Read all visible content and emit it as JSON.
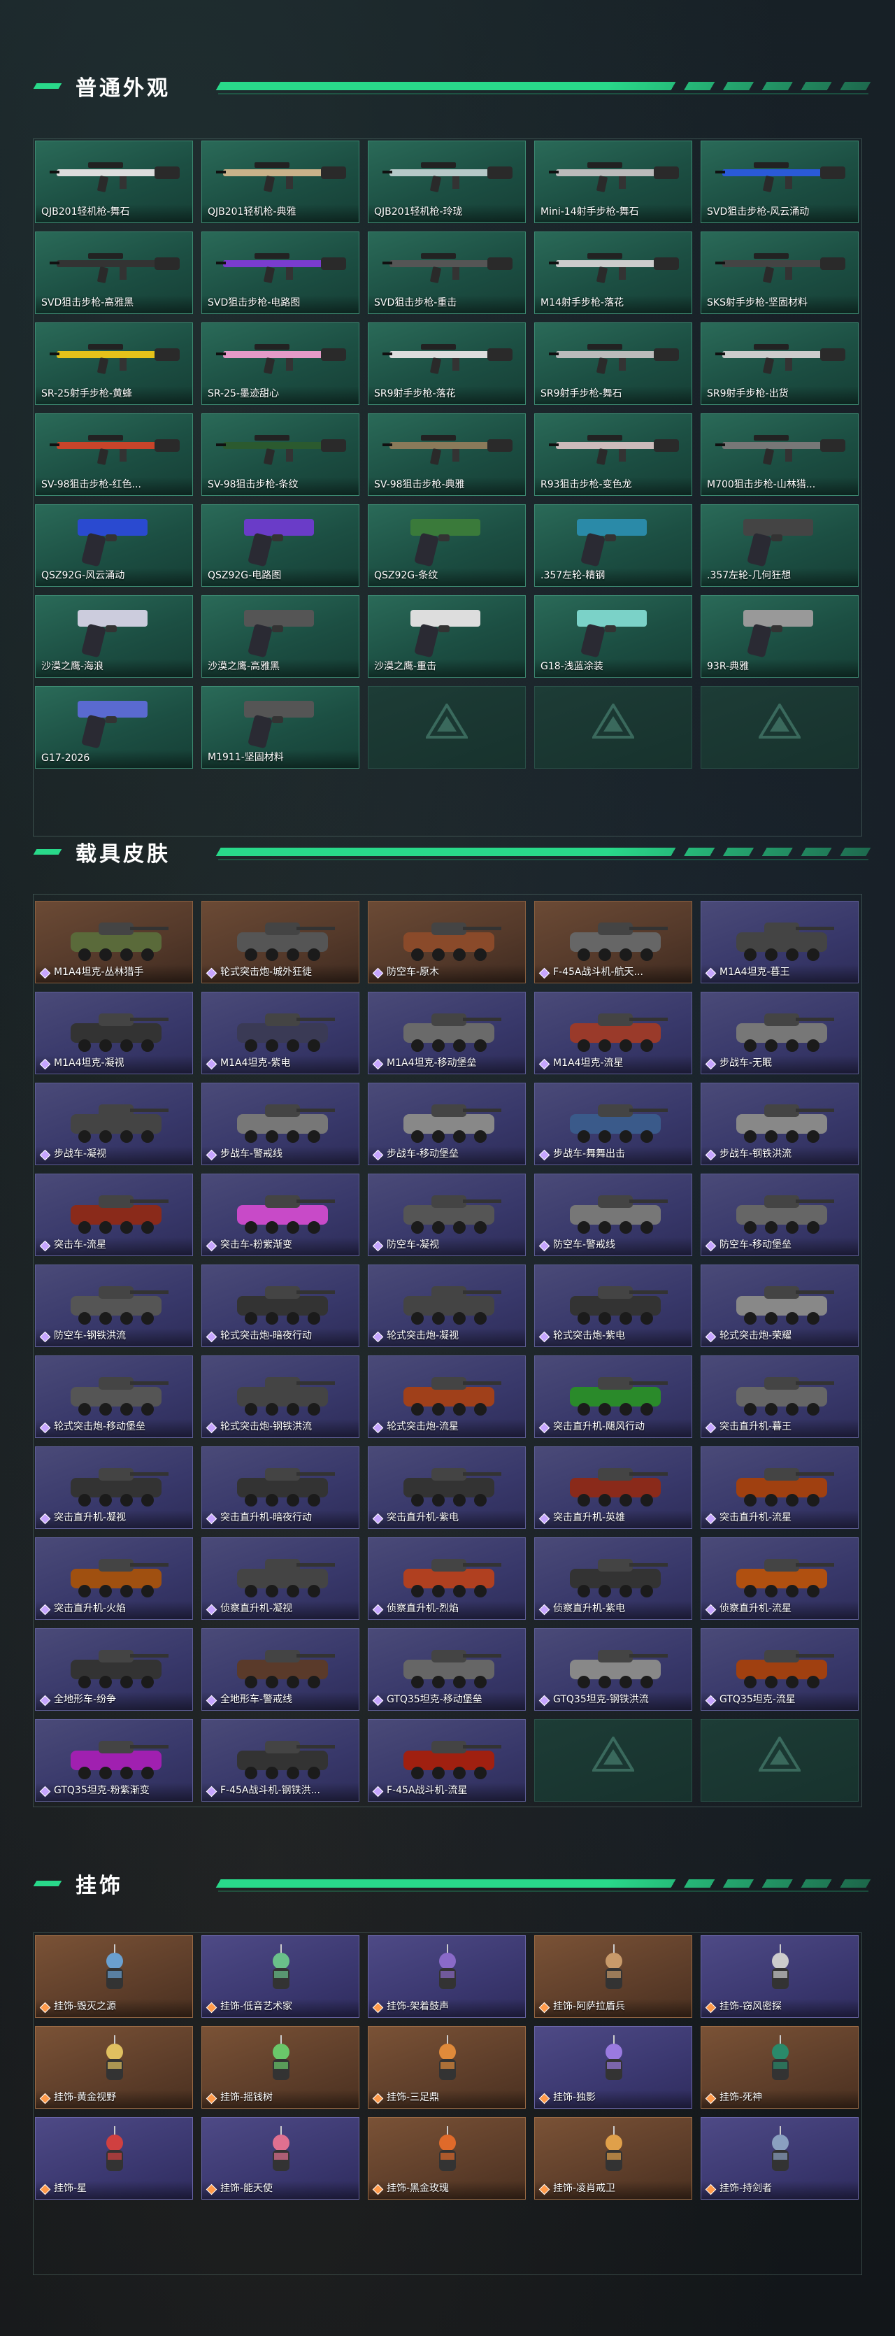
{
  "sections": [
    {
      "title": "普通外观",
      "kind": "weapon",
      "items": [
        {
          "label": "QJB201轻机枪-舞石"
        },
        {
          "label": "QJB201轻机枪-典雅"
        },
        {
          "label": "QJB201轻机枪-玲珑"
        },
        {
          "label": "Mini-14射手步枪-舞石"
        },
        {
          "label": "SVD狙击步枪-风云涌动"
        },
        {
          "label": "SVD狙击步枪-高雅黑"
        },
        {
          "label": "SVD狙击步枪-电路图"
        },
        {
          "label": "SVD狙击步枪-重击"
        },
        {
          "label": "M14射手步枪-落花"
        },
        {
          "label": "SKS射手步枪-坚固材料"
        },
        {
          "label": "SR-25射手步枪-黄蜂"
        },
        {
          "label": "SR-25-墨迹甜心"
        },
        {
          "label": "SR9射手步枪-落花"
        },
        {
          "label": "SR9射手步枪-舞石"
        },
        {
          "label": "SR9射手步枪-出货"
        },
        {
          "label": "SV-98狙击步枪-红色..."
        },
        {
          "label": "SV-98狙击步枪-条纹"
        },
        {
          "label": "SV-98狙击步枪-典雅"
        },
        {
          "label": "R93狙击步枪-变色龙"
        },
        {
          "label": "M700狙击步枪-山林猎..."
        },
        {
          "label": "QSZ92G-风云涌动"
        },
        {
          "label": "QSZ92G-电路图"
        },
        {
          "label": "QSZ92G-条纹"
        },
        {
          "label": ".357左轮-精钢"
        },
        {
          "label": ".357左轮-几何狂想"
        },
        {
          "label": "沙漠之鹰-海浪"
        },
        {
          "label": "沙漠之鹰-高雅黑"
        },
        {
          "label": "沙漠之鹰-重击"
        },
        {
          "label": "G18-浅蓝涂装"
        },
        {
          "label": "93R-典雅"
        },
        {
          "label": "G17-2026"
        },
        {
          "label": "M1911-坚固材料"
        },
        {
          "label": ""
        },
        {
          "label": ""
        },
        {
          "label": ""
        }
      ]
    },
    {
      "title": "载具皮肤",
      "kind": "vehicle",
      "items": [
        {
          "label": "M1A4坦克-丛林猎手"
        },
        {
          "label": "轮式突击炮-城外狂徒"
        },
        {
          "label": "防空车-原木"
        },
        {
          "label": "F-45A战斗机-航天..."
        },
        {
          "label": "M1A4坦克-暮王"
        },
        {
          "label": "M1A4坦克-凝视"
        },
        {
          "label": "M1A4坦克-紫电"
        },
        {
          "label": "M1A4坦克-移动堡垒"
        },
        {
          "label": "M1A4坦克-流星"
        },
        {
          "label": "步战车-无眠"
        },
        {
          "label": "步战车-凝视"
        },
        {
          "label": "步战车-警戒线"
        },
        {
          "label": "步战车-移动堡垒"
        },
        {
          "label": "步战车-舞舞出击"
        },
        {
          "label": "步战车-钢铁洪流"
        },
        {
          "label": "突击车-流星"
        },
        {
          "label": "突击车-粉紫渐变"
        },
        {
          "label": "防空车-凝视"
        },
        {
          "label": "防空车-警戒线"
        },
        {
          "label": "防空车-移动堡垒"
        },
        {
          "label": "防空车-钢铁洪流"
        },
        {
          "label": "轮式突击炮-暗夜行动"
        },
        {
          "label": "轮式突击炮-凝视"
        },
        {
          "label": "轮式突击炮-紫电"
        },
        {
          "label": "轮式突击炮-荣耀"
        },
        {
          "label": "轮式突击炮-移动堡垒"
        },
        {
          "label": "轮式突击炮-钢铁洪流"
        },
        {
          "label": "轮式突击炮-流星"
        },
        {
          "label": "突击直升机-飓风行动"
        },
        {
          "label": "突击直升机-暮王"
        },
        {
          "label": "突击直升机-凝视"
        },
        {
          "label": "突击直升机-暗夜行动"
        },
        {
          "label": "突击直升机-紫电"
        },
        {
          "label": "突击直升机-英雄"
        },
        {
          "label": "突击直升机-流星"
        },
        {
          "label": "突击直升机-火焰"
        },
        {
          "label": "侦察直升机-凝视"
        },
        {
          "label": "侦察直升机-烈焰"
        },
        {
          "label": "侦察直升机-紫电"
        },
        {
          "label": "侦察直升机-流星"
        },
        {
          "label": "全地形车-纷争"
        },
        {
          "label": "全地形车-警戒线"
        },
        {
          "label": "GTQ35坦克-移动堡垒"
        },
        {
          "label": "GTQ35坦克-钢铁洪流"
        },
        {
          "label": "GTQ35坦克-流星"
        },
        {
          "label": "GTQ35坦克-粉紫渐变"
        },
        {
          "label": "F-45A战斗机-钢铁洪..."
        },
        {
          "label": "F-45A战斗机-流星"
        },
        {
          "label": ""
        },
        {
          "label": ""
        }
      ]
    },
    {
      "title": "挂饰",
      "kind": "pendant",
      "items": [
        {
          "label": "挂饰-毁灭之源"
        },
        {
          "label": "挂饰-低音艺术家"
        },
        {
          "label": "挂饰-架着鼓声"
        },
        {
          "label": "挂饰-阿萨拉盾兵"
        },
        {
          "label": "挂饰-窃风密探"
        },
        {
          "label": "挂饰-黄金视野"
        },
        {
          "label": "挂饰-摇钱树"
        },
        {
          "label": "挂饰-三足鼎"
        },
        {
          "label": "挂饰-独影"
        },
        {
          "label": "挂饰-死神"
        },
        {
          "label": "挂饰-星"
        },
        {
          "label": "挂饰-能天使"
        },
        {
          "label": "挂饰-黑金玫瑰"
        },
        {
          "label": "挂饰-凌肖戒卫"
        },
        {
          "label": "挂饰-持剑者"
        }
      ]
    }
  ],
  "colors": {
    "accent": "#29d98a",
    "purple_diamond": "#c7a6ff",
    "orange_diamond": "#ff9a4a"
  }
}
